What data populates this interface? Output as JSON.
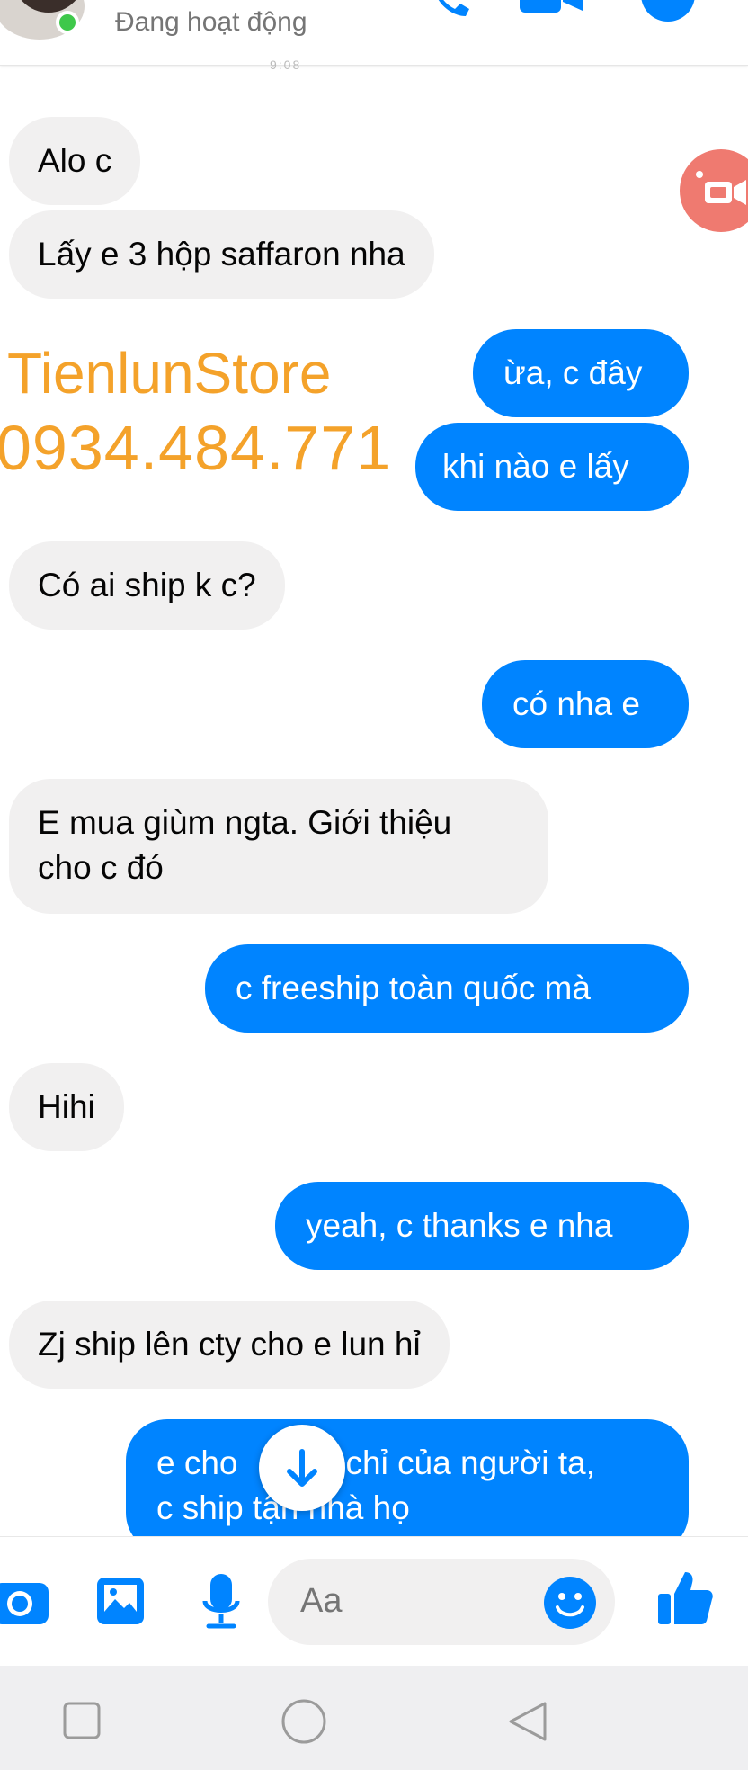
{
  "header": {
    "status": "Đang hoạt động",
    "time_peek": "9:08"
  },
  "watermark": {
    "store": "TienlunStore",
    "phone": "0934.484.771"
  },
  "messages": [
    {
      "side": "in",
      "text": "Alo c"
    },
    {
      "side": "in",
      "text": "Lấy e 3 hộp saffaron nha"
    },
    {
      "side": "out",
      "text": "ừa, c đây"
    },
    {
      "side": "out",
      "text": "khi nào e lấy"
    },
    {
      "side": "in",
      "text": "Có ai ship k c?"
    },
    {
      "side": "out",
      "text": "có nha e"
    },
    {
      "side": "in",
      "line1": "E mua giùm ngta. Giới thiệu",
      "line2": "cho c đó"
    },
    {
      "side": "out",
      "text": "c freeship toàn quốc mà"
    },
    {
      "side": "in",
      "text": "Hihi"
    },
    {
      "side": "out",
      "text": "yeah, c thanks e nha"
    },
    {
      "side": "in",
      "text": "Zj ship lên cty cho e lun hỉ"
    },
    {
      "side": "out",
      "line1a": "e cho",
      "line1b": "chỉ của người ta,",
      "line2": "c ship tận nhà họ"
    }
  ],
  "composer": {
    "placeholder": "Aa"
  },
  "colors": {
    "accent": "#0084ff",
    "incoming_bubble": "#f1f0f0",
    "watermark": "#f4a22a",
    "online": "#3ec84a"
  },
  "icons": [
    "phone-icon",
    "video-call-icon",
    "info-icon",
    "camera-icon",
    "gallery-icon",
    "microphone-icon",
    "emoji-icon",
    "like-icon",
    "scroll-down-icon",
    "video-fab-icon",
    "nav-recents-icon",
    "nav-home-icon",
    "nav-back-icon"
  ]
}
